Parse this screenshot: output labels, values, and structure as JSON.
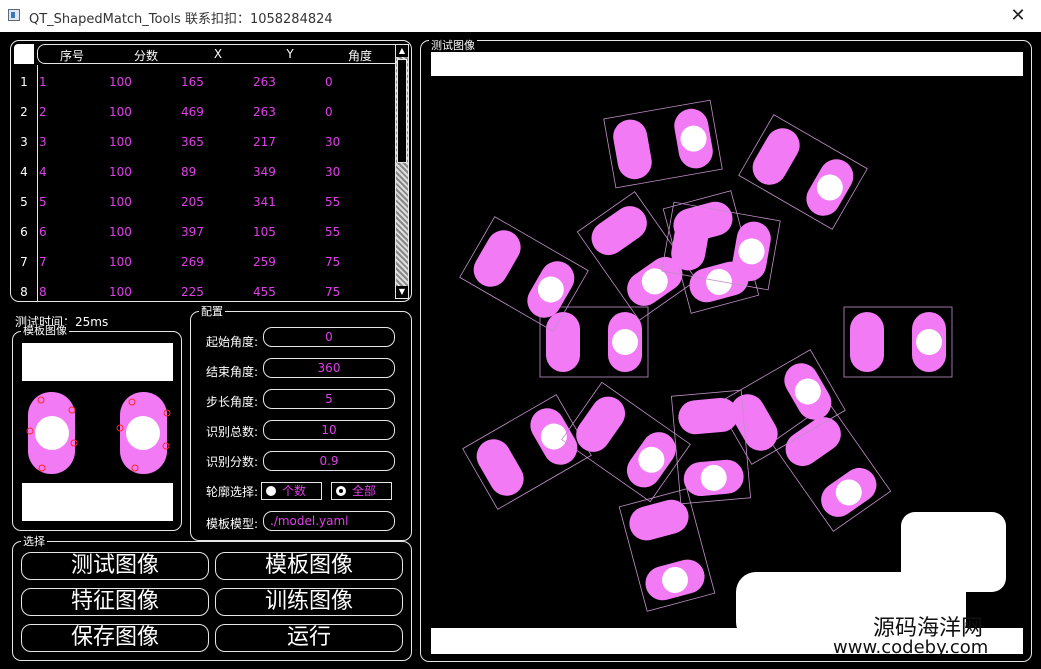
{
  "window": {
    "title": "QT_ShapedMatch_Tools   联系扣扣：1058284824",
    "close_glyph": "✕"
  },
  "table": {
    "headers": [
      "序号",
      "分数",
      "X",
      "Y",
      "角度"
    ],
    "row_numbers": [
      "1",
      "2",
      "3",
      "4",
      "5",
      "6",
      "7",
      "8"
    ],
    "rows": [
      [
        "1",
        "100",
        "165",
        "263",
        "0"
      ],
      [
        "2",
        "100",
        "469",
        "263",
        "0"
      ],
      [
        "3",
        "100",
        "365",
        "217",
        "30"
      ],
      [
        "4",
        "100",
        "89",
        "349",
        "30"
      ],
      [
        "5",
        "100",
        "205",
        "341",
        "55"
      ],
      [
        "6",
        "100",
        "397",
        "105",
        "55"
      ],
      [
        "7",
        "100",
        "269",
        "259",
        "75"
      ],
      [
        "8",
        "100",
        "225",
        "455",
        "75"
      ]
    ]
  },
  "test_time": "测试时间：25ms",
  "template_group": {
    "label": "模板图像"
  },
  "config": {
    "label": "配置",
    "fields": [
      {
        "label": "起始角度:",
        "value": "0"
      },
      {
        "label": "结束角度:",
        "value": "360"
      },
      {
        "label": "步长角度:",
        "value": "5"
      },
      {
        "label": "识别总数:",
        "value": "10"
      },
      {
        "label": "识别分数:",
        "value": "0.9"
      }
    ],
    "contour_label": "轮廓选择:",
    "radio_count": "个数",
    "radio_all": "全部",
    "model_label": "模板模型:",
    "model_value": "./model.yaml"
  },
  "selection": {
    "label": "选择",
    "buttons": [
      "测试图像",
      "模板图像",
      "特征图像",
      "训练图像",
      "保存图像",
      "运行"
    ]
  },
  "image_group": {
    "label": "测试图像"
  },
  "watermark": {
    "line1": "源码海洋网",
    "line2": "www.codeby.com"
  },
  "colors": {
    "accent": "#e040e8",
    "shape": "#f27af5",
    "box": "#c090c8"
  }
}
